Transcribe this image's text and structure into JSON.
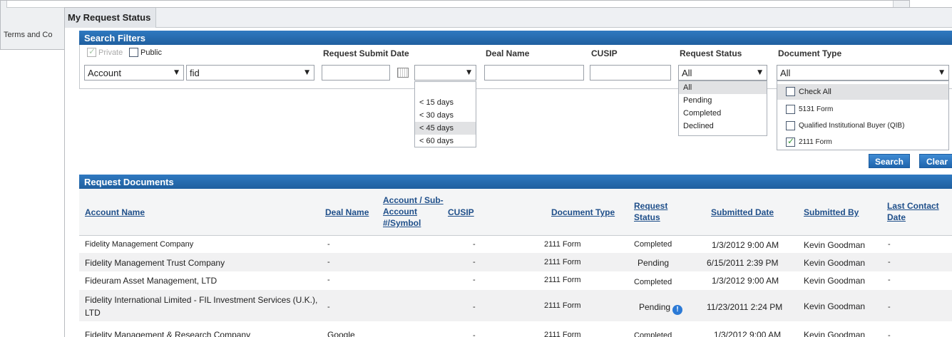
{
  "background": {
    "terms_text": "Terms and Co"
  },
  "tab": {
    "label": "My Request Status"
  },
  "search_filters": {
    "title": "Search Filters",
    "private_label": "Private",
    "public_label": "Public",
    "account_type_value": "Account",
    "account_value": "fid",
    "request_submit_date_label": "Request Submit Date",
    "date_value": "",
    "deal_name_label": "Deal Name",
    "deal_name_value": "",
    "cusip_label": "CUSIP",
    "cusip_value": "",
    "request_status_label": "Request Status",
    "request_status_value": "All",
    "document_type_label": "Document Type",
    "document_type_value": "All"
  },
  "date_range_options": [
    "< 15 days",
    "< 30 days",
    "< 45 days",
    "< 60 days"
  ],
  "request_status_options": [
    "All",
    "Pending",
    "Completed",
    "Declined"
  ],
  "document_type_options": {
    "check_all": "Check All",
    "items": [
      "5131 Form",
      "Qualified Institutional Buyer (QIB)",
      "2111 Form"
    ]
  },
  "buttons": {
    "search": "Search",
    "clear": "Clear"
  },
  "request_documents": {
    "title": "Request Documents",
    "headers": {
      "account_name": "Account Name",
      "deal_name": "Deal Name",
      "account_sub_1": "Account / Sub-",
      "account_sub_2": "Account",
      "account_sub_3": "#/Symbol",
      "cusip": "CUSIP",
      "document_type": "Document Type",
      "request_status_1": "Request",
      "request_status_2": "Status",
      "submitted_date": "Submitted Date",
      "submitted_by": "Submitted By",
      "last_contact_1": "Last Contact",
      "last_contact_2": "Date"
    },
    "rows": [
      {
        "account_name": "Fidelity Management Company",
        "deal_name": "-",
        "cusip": "-",
        "document_type": "2111 Form",
        "status": "Completed",
        "submitted_date": "1/3/2012 9:00 AM",
        "submitted_by": "Kevin Goodman",
        "last_contact": "-"
      },
      {
        "account_name": "Fidelity Management Trust Company",
        "deal_name": "-",
        "cusip": "-",
        "document_type": "2111 Form",
        "status": "Pending",
        "submitted_date": "6/15/2011 2:39 PM",
        "submitted_by": "Kevin Goodman",
        "last_contact": "-"
      },
      {
        "account_name": "Fideuram Asset Management, LTD",
        "deal_name": "-",
        "cusip": "-",
        "document_type": "2111 Form",
        "status": "Completed",
        "submitted_date": "1/3/2012 9:00 AM",
        "submitted_by": "Kevin Goodman",
        "last_contact": "-"
      },
      {
        "account_name_1": "Fidelity International Limited - FIL Investment Services (U.K.),",
        "account_name_2": "LTD",
        "deal_name": "-",
        "cusip": "-",
        "document_type": "2111 Form",
        "status": "Pending",
        "submitted_date": "11/23/2011 2:24 PM",
        "submitted_by": "Kevin Goodman",
        "last_contact": "-"
      },
      {
        "account_name": "Fidelity Management & Research Company",
        "deal_name": "Google",
        "cusip": "-",
        "document_type": "2111 Form",
        "status": "Completed",
        "submitted_date": "1/3/2012 9:00 AM",
        "submitted_by": "Kevin Goodman",
        "last_contact": "-"
      }
    ]
  }
}
